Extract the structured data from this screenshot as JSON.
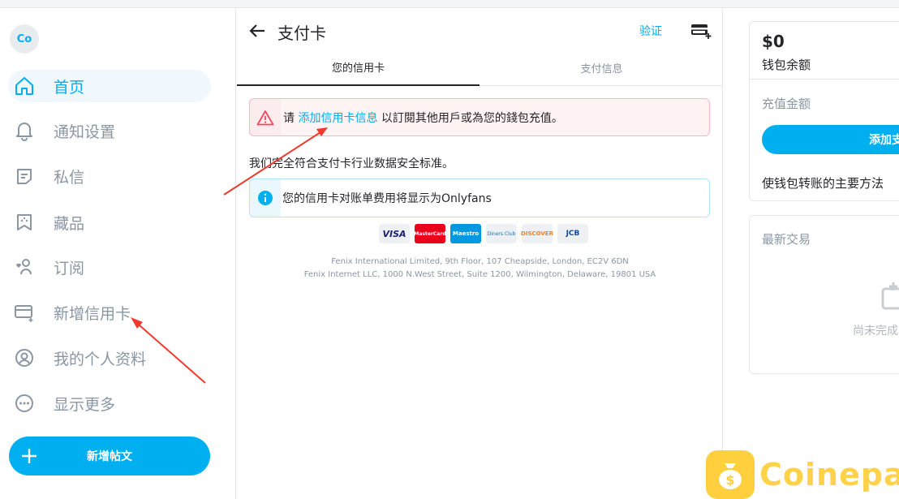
{
  "colors": {
    "accent": "#00aff0",
    "alert_red": "#f0475b",
    "text": "#242529",
    "muted": "#8a96a3"
  },
  "sidebar": {
    "avatar": "Co",
    "items": [
      {
        "label": "首页",
        "icon": "home-icon"
      },
      {
        "label": "通知设置",
        "icon": "bell-icon"
      },
      {
        "label": "私信",
        "icon": "message-icon"
      },
      {
        "label": "藏品",
        "icon": "bookmark-icon"
      },
      {
        "label": "订阅",
        "icon": "user-heart-icon"
      },
      {
        "label": "新增信用卡",
        "icon": "add-card-icon"
      },
      {
        "label": "我的个人资料",
        "icon": "profile-icon"
      },
      {
        "label": "显示更多",
        "icon": "more-icon"
      }
    ],
    "new_post": "新增帖文"
  },
  "main": {
    "title": "支付卡",
    "verify": "验证",
    "tabs": [
      "您的信用卡",
      "支付信息"
    ],
    "alert": {
      "prefix": "请 ",
      "link": "添加信用卡信息",
      "suffix": " 以訂閱其他用戶或為您的錢包充值。"
    },
    "compliance": "我们完全符合支付卡行业数据安全标准。",
    "info": "您的信用卡对账单费用将显示为Onlyfans",
    "cards": [
      "VISA",
      "MasterCard",
      "Maestro",
      "Diners Club",
      "DISCOVER",
      "JCB"
    ],
    "address_lines": [
      "Fenix International Limited, 9th Floor, 107 Cheapside, London, EC2V 6DN",
      "Fenix Internet LLC, 1000 N.West Street, Suite 1200, Wilmington, Delaware, 19801 USA"
    ]
  },
  "wallet": {
    "balance": "$0",
    "balance_label": "钱包余额",
    "topup_label": "充值金额",
    "topup_button": "添加支",
    "primary_method": "使钱包转账的主要方法"
  },
  "transactions": {
    "title": "最新交易",
    "empty": "尚未完成"
  },
  "watermark": "Coinepay"
}
